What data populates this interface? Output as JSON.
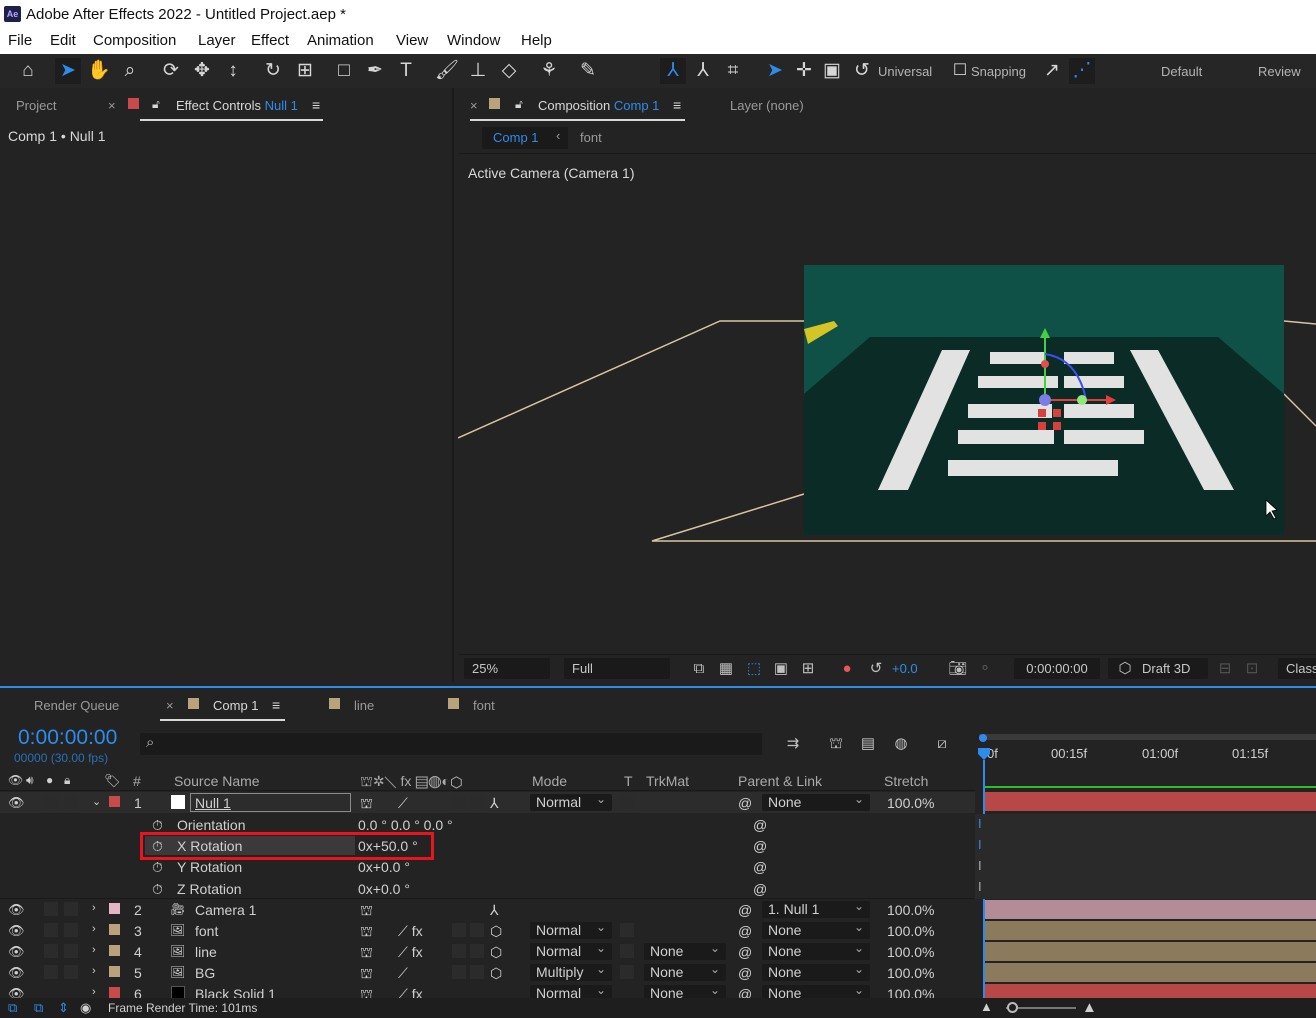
{
  "app": {
    "logo_text": "Ae",
    "title": "Adobe After Effects 2022 - Untitled Project.aep *"
  },
  "menu": [
    "File",
    "Edit",
    "Composition",
    "Layer",
    "Effect",
    "Animation",
    "View",
    "Window",
    "Help"
  ],
  "toolbar": {
    "universal_label": "Universal",
    "snapping_label": "Snapping",
    "workspace_default": "Default",
    "workspace_review": "Review"
  },
  "left_panel": {
    "project_tab": "Project",
    "close_glyph": "×",
    "effect_controls_tab": "Effect Controls",
    "effect_controls_target": "Null 1",
    "menu_glyph": "≡",
    "breadcrumb": "Comp 1 • Null 1"
  },
  "comp_panel": {
    "close_glyph": "×",
    "composition_tab": "Composition",
    "composition_name": "Comp 1",
    "menu_glyph": "≡",
    "layer_tab": "Layer (none)",
    "subtab_comp": "Comp 1",
    "subtab_arrow": "‹",
    "subtab_font": "font",
    "camera_label": "Active Camera (Camera 1)"
  },
  "viewer_bar": {
    "zoom": "25%",
    "resolution": "Full",
    "exposure": "+0.0",
    "timecode": "0:00:00:00",
    "renderer": "Draft 3D",
    "extra": "Class"
  },
  "timeline": {
    "tabs": {
      "render_queue": "Render Queue",
      "close_glyph": "×",
      "comp": "Comp 1",
      "menu_glyph": "≡",
      "line": "line",
      "font": "font"
    },
    "timecode": "0:00:00:00",
    "frames": "00000 (30.00 fps)",
    "search_icon": "⌕",
    "ruler": [
      "0f",
      "00:15f",
      "01:00f",
      "01:15f"
    ],
    "columns": {
      "number": "#",
      "source_name": "Source Name",
      "mode": "Mode",
      "t": "T",
      "trkmat": "TrkMat",
      "parent": "Parent & Link",
      "stretch": "Stretch"
    },
    "layers": [
      {
        "num": "1",
        "name": "Null 1",
        "mode": "Normal",
        "trkmat": "",
        "parent": "None",
        "stretch": "100.0%",
        "color": "#c84a4a",
        "icon": "null-icon",
        "expanded": true
      },
      {
        "num": "2",
        "name": "Camera 1",
        "mode": "",
        "trkmat": "",
        "parent": "1. Null 1",
        "stretch": "100.0%",
        "color": "#e6b4c4",
        "icon": "camera-icon",
        "expanded": false
      },
      {
        "num": "3",
        "name": "font",
        "mode": "Normal",
        "trkmat": "",
        "parent": "None",
        "stretch": "100.0%",
        "color": "#b9a27c",
        "icon": "footage-icon",
        "expanded": false
      },
      {
        "num": "4",
        "name": "line",
        "mode": "Normal",
        "trkmat": "None",
        "parent": "None",
        "stretch": "100.0%",
        "color": "#b9a27c",
        "icon": "footage-icon",
        "expanded": false
      },
      {
        "num": "5",
        "name": "BG",
        "mode": "Multiply",
        "trkmat": "None",
        "parent": "None",
        "stretch": "100.0%",
        "color": "#b9a27c",
        "icon": "footage-icon",
        "expanded": false
      },
      {
        "num": "6",
        "name": "Black Solid 1",
        "mode": "Normal",
        "trkmat": "None",
        "parent": "None",
        "stretch": "100.0%",
        "color": "#c84a4a",
        "icon": "solid-icon",
        "expanded": false
      }
    ],
    "properties": [
      {
        "name": "Orientation",
        "value": "0.0 ° 0.0 ° 0.0 °",
        "highlighted": false
      },
      {
        "name": "X Rotation",
        "value": "0x+50.0 °",
        "highlighted": true
      },
      {
        "name": "Y Rotation",
        "value": "0x+0.0 °",
        "highlighted": false
      },
      {
        "name": "Z Rotation",
        "value": "0x+0.0 °",
        "highlighted": false
      }
    ],
    "status_label": "Frame Render Time:",
    "status_value": "101ms"
  },
  "colors": {
    "accent": "#2d8ceb",
    "highlight_box": "#e8141e",
    "comp_bg": "#0d3a32",
    "bar_red": "#b84848",
    "bar_pink": "#b48c98",
    "bar_tan": "#8c7a5c"
  }
}
